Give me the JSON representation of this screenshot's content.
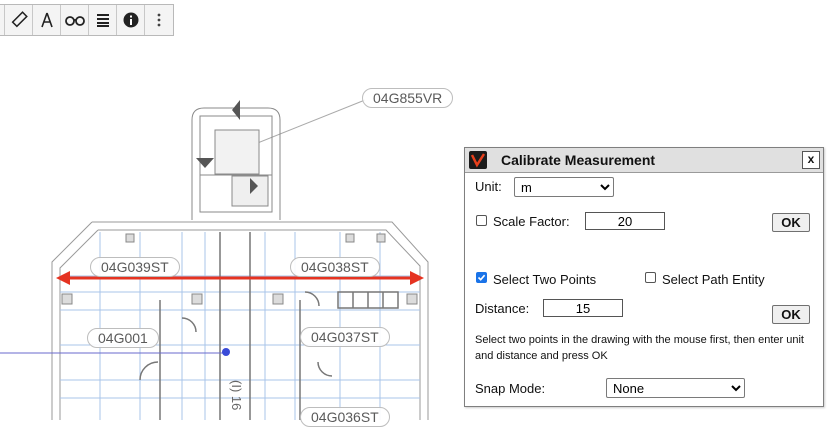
{
  "toolbar": {
    "buttons": [
      {
        "icon": "ruler-icon"
      },
      {
        "icon": "compass-icon"
      },
      {
        "icon": "binoculars-icon"
      },
      {
        "icon": "layers-icon"
      },
      {
        "icon": "info-icon"
      },
      {
        "icon": "more-icon"
      }
    ]
  },
  "drawing": {
    "labels": {
      "top": "04G855VR",
      "left_upper": "04G039ST",
      "center_upper": "04G038ST",
      "left_mid": "04G001",
      "right_mid": "04G037ST",
      "right_low": "04G036ST",
      "vertical": "(I) 16"
    },
    "measure_color": "#e53321"
  },
  "dialog": {
    "title": "Calibrate Measurement",
    "close": "x",
    "unit_label": "Unit:",
    "unit_value": "m",
    "unit_options": [
      "m"
    ],
    "scale_factor_label": "Scale Factor:",
    "scale_factor_value": "20",
    "scale_factor_checked": false,
    "ok1": "OK",
    "two_points_label": "Select Two Points",
    "two_points_checked": true,
    "path_entity_label": "Select Path Entity",
    "path_entity_checked": false,
    "distance_label": "Distance:",
    "distance_value": "15",
    "ok2": "OK",
    "help_line1": "Select two points in the drawing with the mouse first, then enter unit",
    "help_line2": "and distance and press OK",
    "snap_label": "Snap Mode:",
    "snap_value": "None",
    "snap_options": [
      "None"
    ]
  }
}
